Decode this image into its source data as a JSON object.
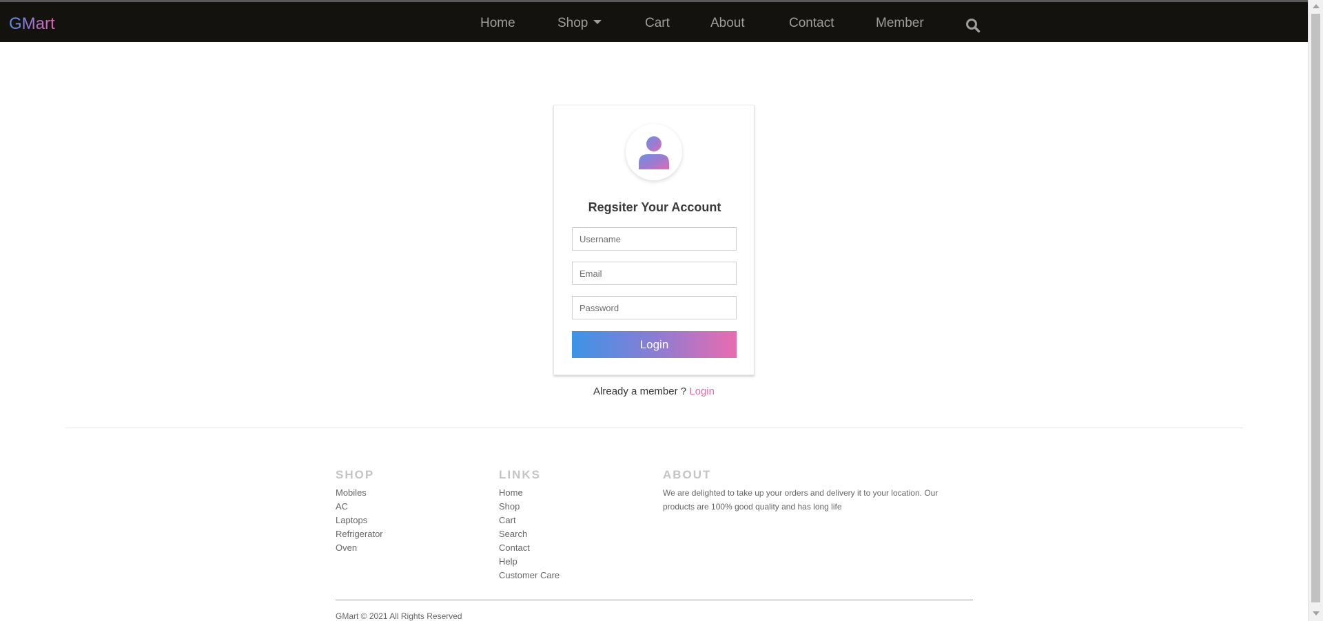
{
  "brand": "GMart",
  "nav": {
    "items": [
      "Home",
      "Shop",
      "Cart",
      "About",
      "Contact",
      "Member"
    ],
    "search_icon": "search-icon"
  },
  "register": {
    "title": "Regsiter Your Account",
    "username_placeholder": "Username",
    "email_placeholder": "Email",
    "password_placeholder": "Password",
    "button_label": "Login",
    "already_text": "Already a member ?",
    "login_link": "Login",
    "avatar_icon": "user-icon"
  },
  "footer": {
    "shop_heading": "SHOP",
    "shop_items": [
      "Mobiles",
      "AC",
      "Laptops",
      "Refrigerator",
      "Oven"
    ],
    "links_heading": "LINKS",
    "links_items": [
      "Home",
      "Shop",
      "Cart",
      "Search",
      "Contact",
      "Help",
      "Customer Care"
    ],
    "about_heading": "ABOUT",
    "about_text": "We are delighted to take up your orders and delivery it to your location. Our products are 100% good quality and has long life",
    "copyright": "GMart © 2021 All Rights Reserved"
  },
  "colors": {
    "navbar": "#13120e",
    "accent_start": "#3c94e6",
    "accent_end": "#ea6cb0",
    "link_pink": "#e16cb0"
  }
}
